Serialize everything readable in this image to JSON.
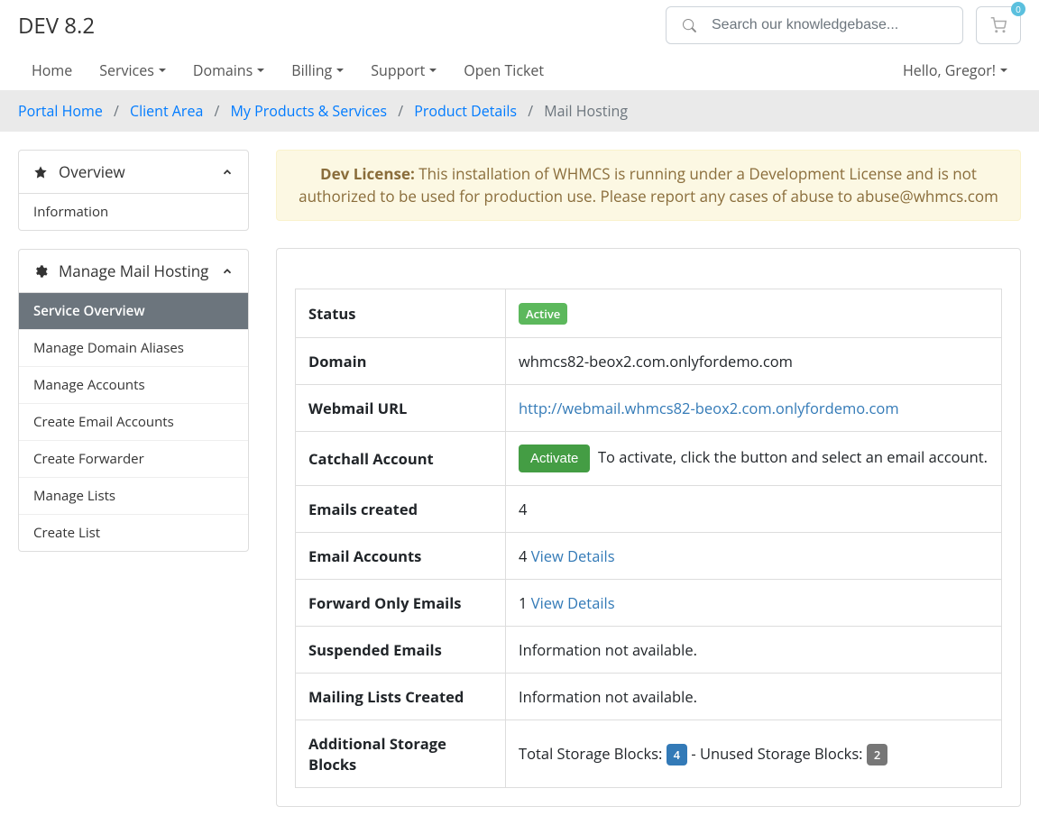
{
  "header": {
    "brand": "DEV 8.2",
    "search_placeholder": "Search our knowledgebase...",
    "cart_count": "0"
  },
  "nav": {
    "home": "Home",
    "services": "Services",
    "domains": "Domains",
    "billing": "Billing",
    "support": "Support",
    "open_ticket": "Open Ticket",
    "hello": "Hello, Gregor!"
  },
  "breadcrumb": {
    "portal_home": "Portal Home",
    "client_area": "Client Area",
    "products": "My Products & Services",
    "product_details": "Product Details",
    "current": "Mail Hosting"
  },
  "sidebar": {
    "overview": {
      "title": "Overview",
      "items": {
        "information": "Information"
      }
    },
    "manage": {
      "title": "Manage Mail Hosting",
      "items": {
        "service_overview": "Service Overview",
        "domain_aliases": "Manage Domain Aliases",
        "accounts": "Manage Accounts",
        "create_email": "Create Email Accounts",
        "create_forwarder": "Create Forwarder",
        "manage_lists": "Manage Lists",
        "create_list": "Create List"
      }
    }
  },
  "alert": {
    "label": "Dev License:",
    "text": " This installation of WHMCS is running under a Development License and is not authorized to be used for production use. Please report any cases of abuse to abuse@whmcs.com"
  },
  "table": {
    "status": {
      "label": "Status",
      "value": "Active"
    },
    "domain": {
      "label": "Domain",
      "value": "whmcs82-beox2.com.onlyfordemo.com"
    },
    "webmail": {
      "label": "Webmail URL",
      "value": "http://webmail.whmcs82-beox2.com.onlyfordemo.com"
    },
    "catchall": {
      "label": "Catchall Account",
      "button": "Activate",
      "text": "To activate, click the button and select an email account."
    },
    "emails_created": {
      "label": "Emails created",
      "value": "4"
    },
    "email_accounts": {
      "label": "Email Accounts",
      "value": "4 ",
      "link": "View Details"
    },
    "forward_only": {
      "label": "Forward Only Emails",
      "value": "1 ",
      "link": "View Details"
    },
    "suspended": {
      "label": "Suspended Emails",
      "value": "Information not available."
    },
    "mailing_lists": {
      "label": "Mailing Lists Created",
      "value": "Information not available."
    },
    "storage": {
      "label": "Additional Storage Blocks",
      "total_label": "Total Storage Blocks: ",
      "total_value": "4",
      "sep": " - ",
      "unused_label": "Unused Storage Blocks: ",
      "unused_value": "2"
    }
  }
}
